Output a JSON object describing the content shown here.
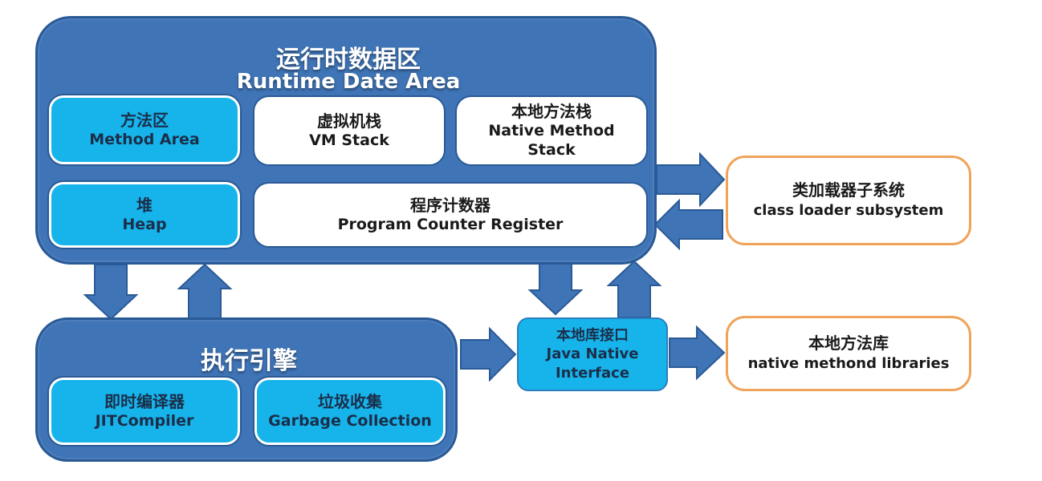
{
  "runtime_area": {
    "title_zh": "运行时数据区",
    "title_en": "Runtime Date Area",
    "method_area": {
      "zh": "方法区",
      "en": "Method Area"
    },
    "vm_stack": {
      "zh": "虚拟机栈",
      "en": "VM Stack"
    },
    "native_method_stack": {
      "zh": "本地方法栈",
      "en_line1": "Native Method",
      "en_line2": "Stack"
    },
    "heap": {
      "zh": "堆",
      "en": "Heap"
    },
    "program_counter": {
      "zh": "程序计数器",
      "en": "Program Counter Register"
    }
  },
  "execution_engine": {
    "title_zh": "执行引擎",
    "jit_compiler": {
      "zh": "即时编译器",
      "en": "JITCompiler"
    },
    "garbage_collection": {
      "zh": "垃圾收集",
      "en": "Garbage Collection"
    }
  },
  "class_loader": {
    "zh": "类加载器子系统",
    "en": "class loader subsystem"
  },
  "jni": {
    "zh": "本地库接口",
    "en_line1": "Java Native",
    "en_line2": "Interface"
  },
  "native_libraries": {
    "zh": "本地方法库",
    "en": "native methond libraries"
  },
  "colors": {
    "container_blue": "#3f74b6",
    "cyan_box": "#16b4ea",
    "arrow_blue": "#3f74b6",
    "orange_border": "#f0a35a"
  }
}
